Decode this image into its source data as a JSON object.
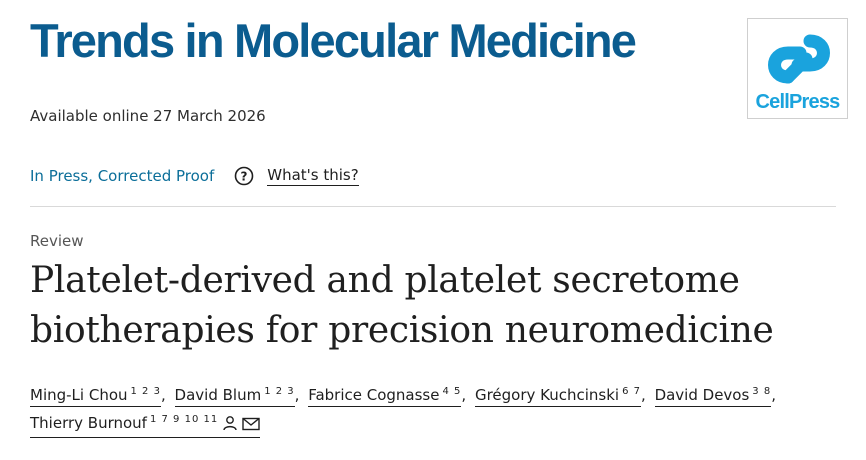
{
  "header": {
    "journal_title": "Trends in Molecular Medicine",
    "publisher_logo_text": "CellPress"
  },
  "meta": {
    "available": "Available online 27 March 2026",
    "status": "In Press, Corrected Proof",
    "whats_this": "What's this?"
  },
  "article": {
    "type": "Review",
    "title": "Platelet-derived and platelet secretome biotherapies for precision neuromedicine"
  },
  "authors": [
    {
      "name": "Ming-Li Chou",
      "affiliations": "1 2 3"
    },
    {
      "name": "David Blum",
      "affiliations": "1 2 3"
    },
    {
      "name": "Fabrice Cognasse",
      "affiliations": "4 5"
    },
    {
      "name": "Grégory Kuchcinski",
      "affiliations": "6 7"
    },
    {
      "name": "David Devos",
      "affiliations": "3 8"
    },
    {
      "name": "Thierry Burnouf",
      "affiliations": "1 7 9 10 11",
      "icons": [
        "person-icon",
        "mail-icon"
      ]
    }
  ],
  "colors": {
    "journal_blue": "#0b5c8f",
    "cellpress_blue": "#1aa3dd",
    "link_blue": "#0b6e99"
  }
}
